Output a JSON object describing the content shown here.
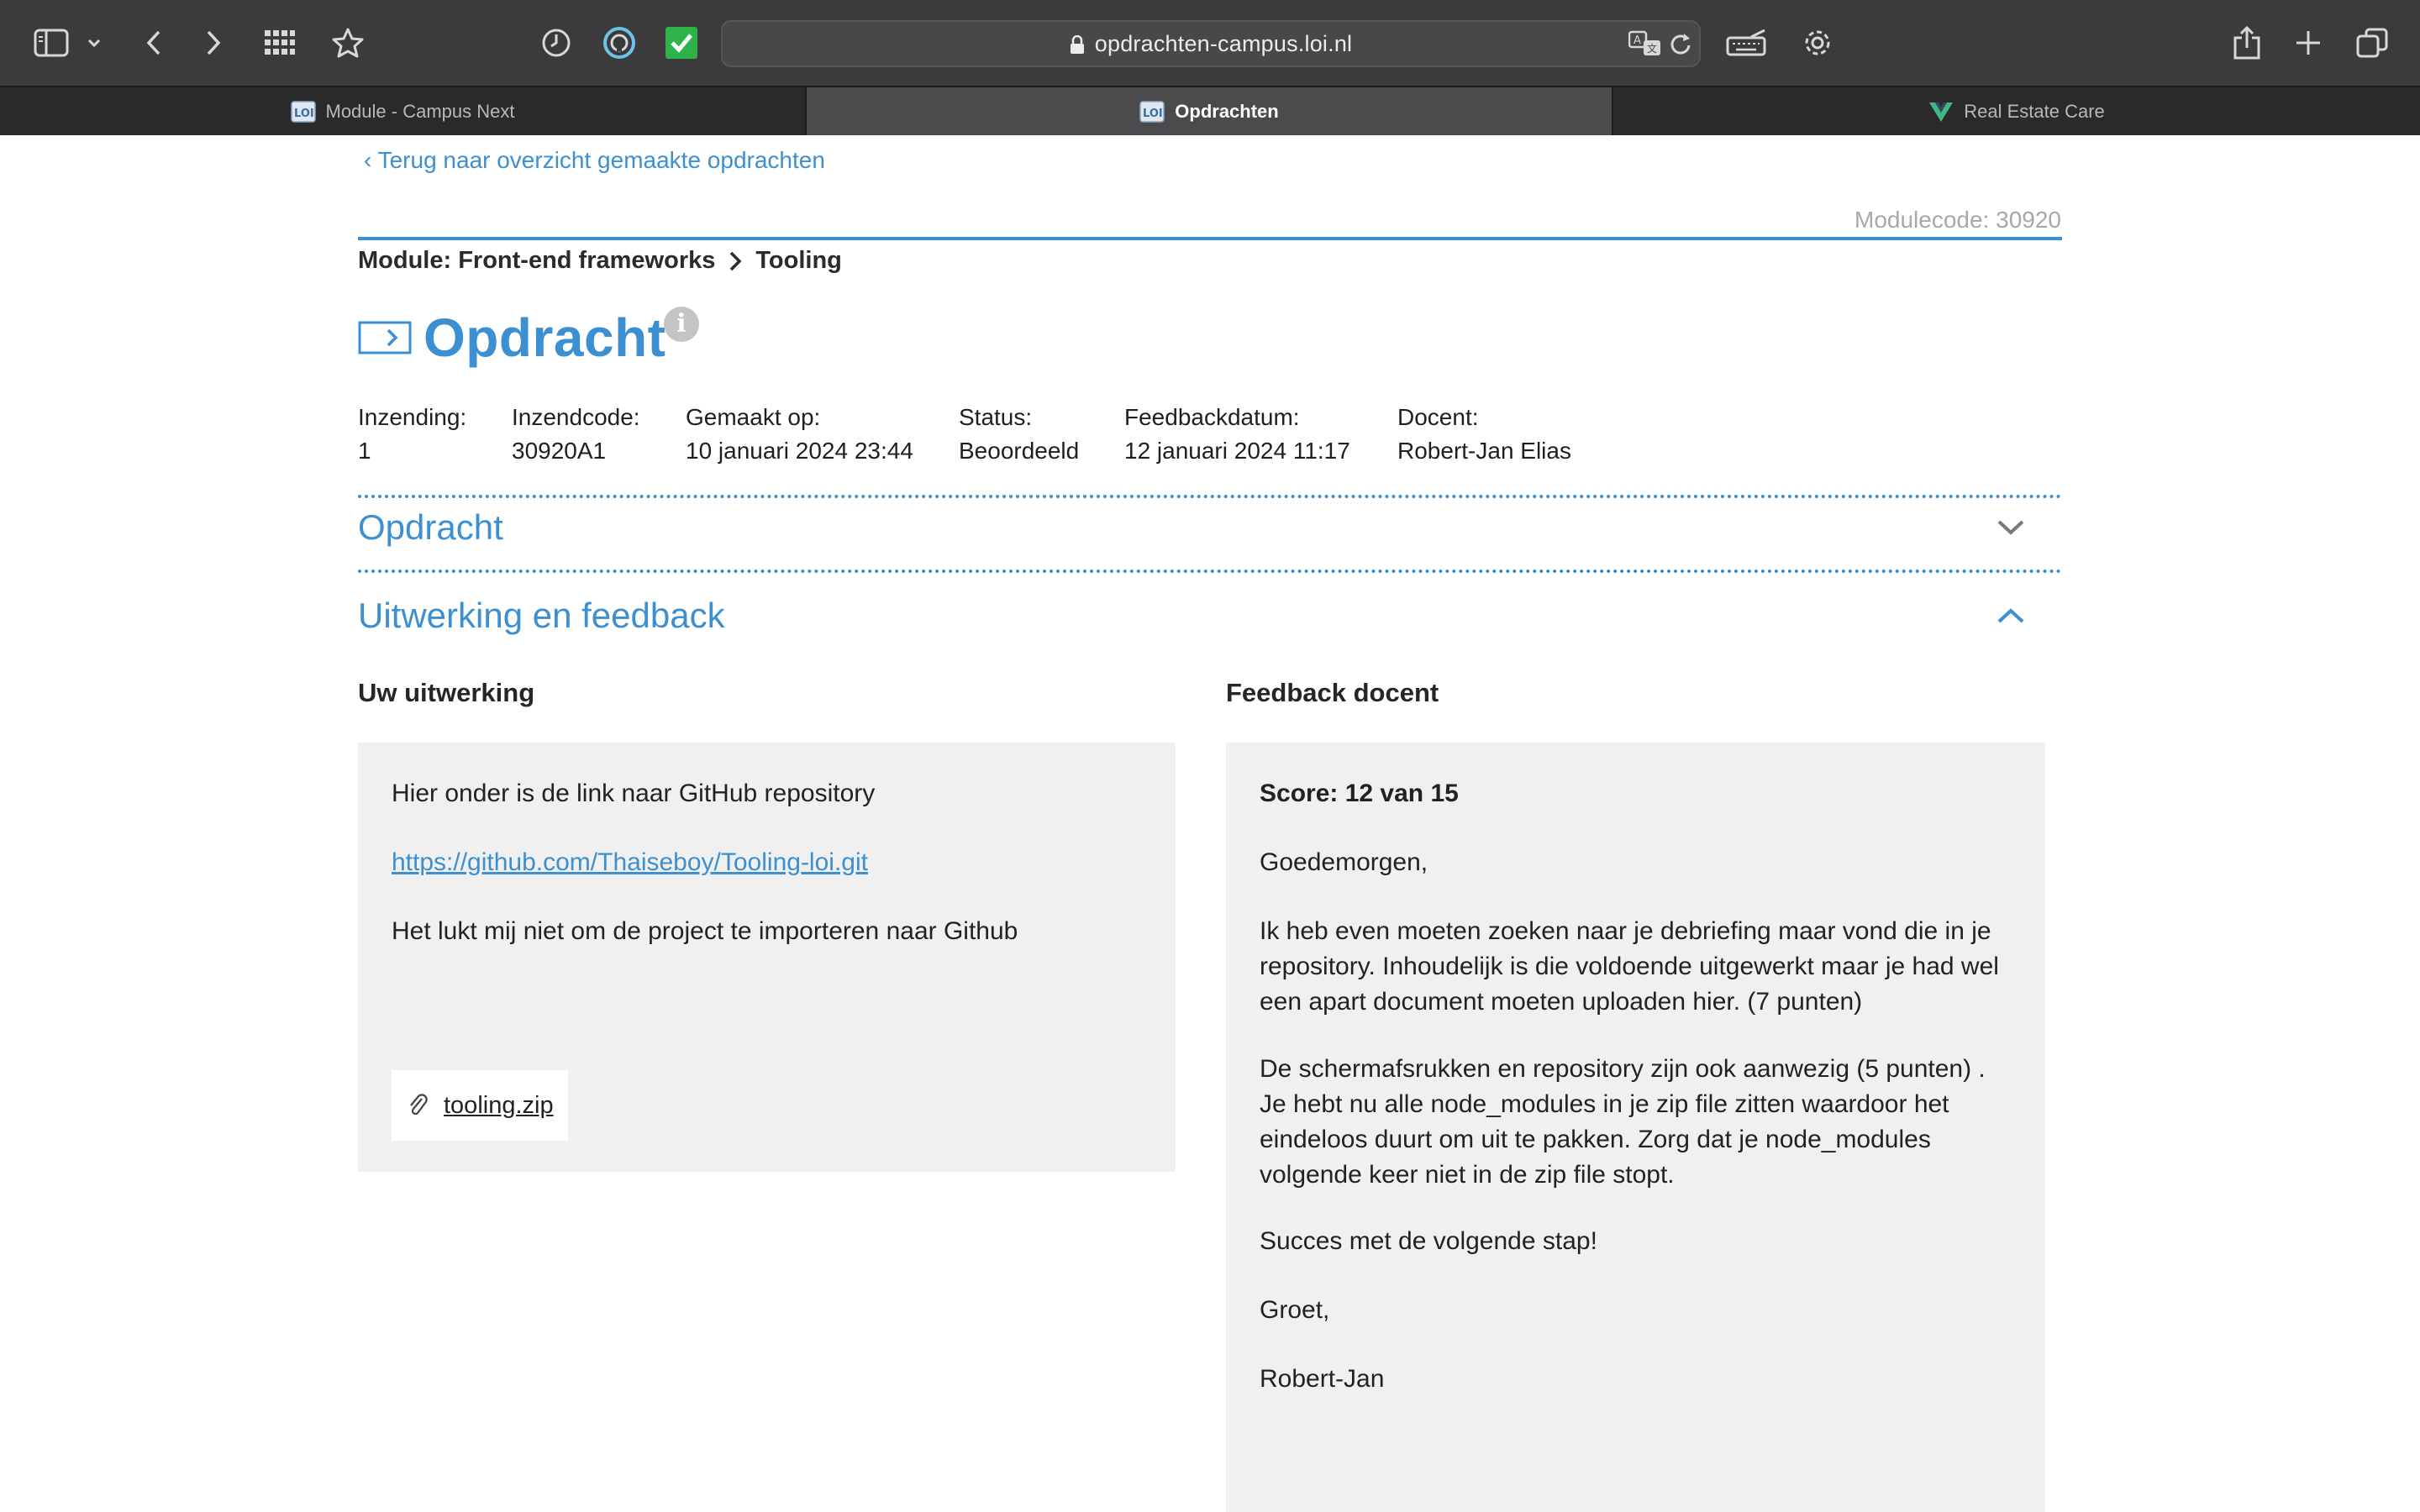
{
  "browser": {
    "url": "opdrachten-campus.loi.nl",
    "tabs": [
      {
        "label": "Module - Campus Next",
        "favicon": "loi-icon",
        "active": false
      },
      {
        "label": "Opdrachten",
        "favicon": "loi-icon",
        "active": true
      },
      {
        "label": "Real Estate Care",
        "favicon": "vue-icon",
        "active": false
      }
    ],
    "toolbar_icons": [
      "sidebar-icon",
      "chevron-down-icon",
      "back-icon",
      "forward-icon",
      "grid-icon",
      "star-icon",
      "history-icon",
      "shield-icon",
      "checkmark-icon",
      "translate-icon",
      "reload-icon",
      "keyboard-icon",
      "gear-icon",
      "share-icon",
      "plus-icon",
      "tabs-icon"
    ]
  },
  "page": {
    "back_link": "‹ Terug naar overzicht gemaakte opdrachten",
    "modulecode": "Modulecode: 30920",
    "breadcrumb": {
      "module": "Module: Front-end frameworks",
      "current": "Tooling"
    },
    "title": "Opdracht",
    "meta": [
      {
        "label": "Inzending:",
        "value": "1"
      },
      {
        "label": "Inzendcode:",
        "value": "30920A1"
      },
      {
        "label": "Gemaakt op:",
        "value": "10 januari 2024 23:44"
      },
      {
        "label": "Status:",
        "value": "Beoordeeld"
      },
      {
        "label": "Feedbackdatum:",
        "value": "12 januari 2024 11:17"
      },
      {
        "label": "Docent:",
        "value": "Robert-Jan Elias"
      }
    ],
    "sections": {
      "opdracht": "Opdracht",
      "uitwerking": "Uitwerking en feedback"
    },
    "uitwerking": {
      "heading": "Uw uitwerking",
      "line1": "Hier onder is de link naar GitHub repository",
      "link": "https://github.com/Thaiseboy/Tooling-loi.git",
      "line2": "Het lukt mij niet om de project te importeren naar Github",
      "attachment": "tooling.zip"
    },
    "feedback": {
      "heading": "Feedback docent",
      "score": "Score: 12 van 15",
      "greeting": "Goedemorgen,",
      "p1_l1": "Ik heb even moeten zoeken naar je debriefing maar vond die in je",
      "p1_l2": "repository. Inhoudelijk is die voldoende uitgewerkt maar je had wel",
      "p1_l3": "een apart document moeten uploaden hier. (7 punten)",
      "p2_l1": "De schermafsrukken en repository zijn ook aanwezig (5 punten) .",
      "p2_l2": "Je hebt nu alle node_modules in je zip file zitten waardoor het",
      "p2_l3": "eindeloos duurt om uit te pakken. Zorg dat je node_modules",
      "p2_l4": "volgende keer niet in de zip file stopt.",
      "closing1": "Succes met de volgende stap!",
      "closing2": "Groet,",
      "signature": "Robert-Jan"
    }
  },
  "colors": {
    "accent": "#3c8fd0",
    "card_bg": "#f0f0f0",
    "toolbar": "#3b3b3d"
  }
}
